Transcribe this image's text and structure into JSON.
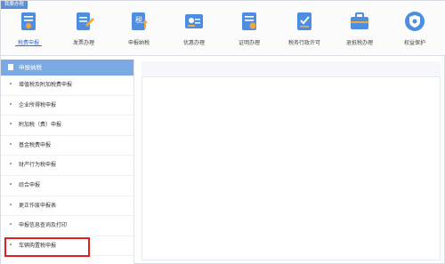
{
  "header": {
    "quick_tag": "我要办税"
  },
  "toolbar": [
    {
      "label": "税费申报",
      "icon": "tax-report-icon",
      "active": true
    },
    {
      "label": "发票办理",
      "icon": "invoice-icon",
      "active": false
    },
    {
      "label": "申报纳税",
      "icon": "declare-icon",
      "active": false
    },
    {
      "label": "优惠办理",
      "icon": "preferential-icon",
      "active": false
    },
    {
      "label": "证明办理",
      "icon": "certificate-icon",
      "active": false
    },
    {
      "label": "税务行政许可",
      "icon": "admin-license-icon",
      "active": false
    },
    {
      "label": "退抵税办理",
      "icon": "refund-icon",
      "active": false
    },
    {
      "label": "权益保护",
      "icon": "protection-icon",
      "active": false
    }
  ],
  "sidebar": {
    "title": "申报纳税",
    "items": [
      {
        "label": "增值税及附加税费申报"
      },
      {
        "label": "企业所得税申报"
      },
      {
        "label": "附加税（费）申报"
      },
      {
        "label": "基金税费申报"
      },
      {
        "label": "财产行为税申报"
      },
      {
        "label": "综合申报"
      },
      {
        "label": "更正作废申报表"
      },
      {
        "label": "申报信息查询及打印"
      },
      {
        "label": "车辆购置税申报"
      }
    ]
  },
  "colors": {
    "accent": "#2e6fd1",
    "sidebar_header": "#7aa9e4",
    "highlight": "#e02020"
  }
}
